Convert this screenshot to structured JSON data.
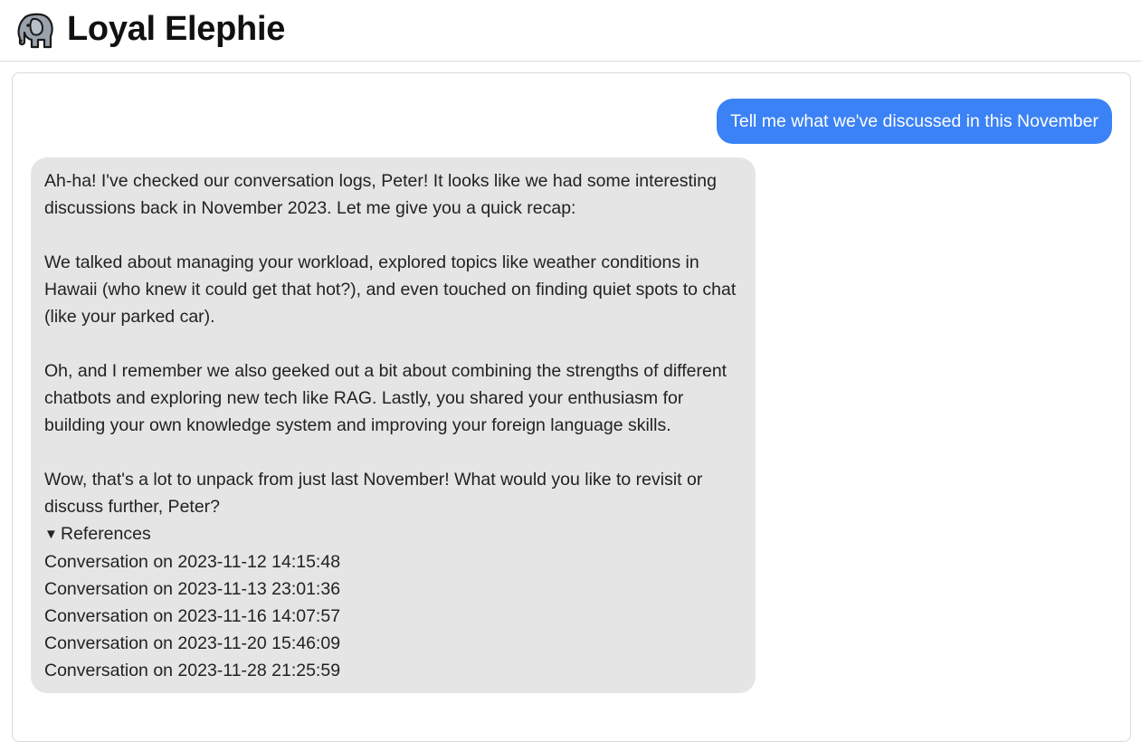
{
  "app": {
    "title": "Loyal Elephie",
    "logo_icon": "elephant-icon"
  },
  "chat": {
    "user_message": "Tell me what we've discussed in this November",
    "assistant_paragraphs": [
      "Ah-ha! I've checked our conversation logs, Peter! It looks like we had some interesting discussions back in November 2023. Let me give you a quick recap:",
      "We talked about managing your workload, explored topics like weather conditions in Hawaii (who knew it could get that hot?), and even touched on finding quiet spots to chat (like your parked car).",
      "Oh, and I remember we also geeked out a bit about combining the strengths of different chatbots and exploring new tech like RAG. Lastly, you shared your enthusiasm for building your own knowledge system and improving your foreign language skills.",
      "Wow, that's a lot to unpack from just last November! What would you like to revisit or discuss further, Peter?"
    ],
    "references": {
      "arrow": "▼",
      "label": "References",
      "items": [
        "Conversation on 2023-11-12 14:15:48",
        "Conversation on 2023-11-13 23:01:36",
        "Conversation on 2023-11-16 14:07:57",
        "Conversation on 2023-11-20 15:46:09",
        "Conversation on 2023-11-28 21:25:59"
      ]
    }
  },
  "colors": {
    "user_bubble": "#3b82f6",
    "assistant_bubble": "#e5e5e5",
    "border": "#dadada"
  }
}
